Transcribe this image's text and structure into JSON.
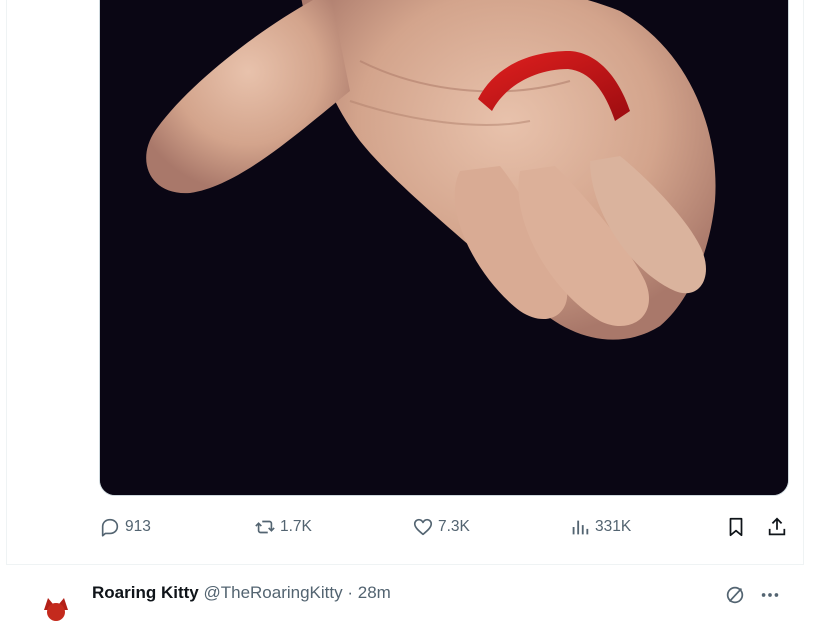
{
  "tweet": {
    "media": {
      "alt": ""
    },
    "actions": {
      "replies": "913",
      "reposts": "1.7K",
      "likes": "7.3K",
      "views": "331K"
    }
  },
  "next_tweet": {
    "author_name": "Roaring Kitty",
    "author_handle": "@TheRoaringKitty",
    "separator": "·",
    "timestamp": "28m"
  },
  "icons": {
    "reply": "reply-icon",
    "repost": "repost-icon",
    "like": "heart-icon",
    "views": "views-chart-icon",
    "bookmark": "bookmark-icon",
    "share": "share-icon",
    "grok": "grok-icon",
    "more": "more-icon"
  },
  "colors": {
    "text_secondary": "#536471",
    "text_primary": "#0f1419",
    "divider": "#eff3f4",
    "media_background": "#0a0614"
  }
}
